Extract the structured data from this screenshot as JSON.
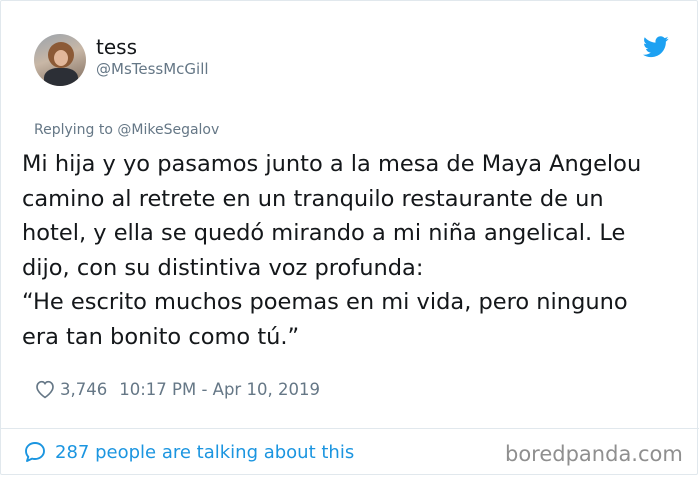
{
  "author": {
    "name": "tess",
    "handle": "@MsTessMcGill"
  },
  "icons": {
    "avatar": "avatar-photo",
    "platform": "twitter-bird-icon",
    "like": "heart-outline-icon",
    "conversation": "speech-bubble-icon"
  },
  "colors": {
    "accent": "#1b95e0",
    "secondary_text": "#657786",
    "primary_text": "#14171a",
    "border": "#e1e8ed",
    "watermark": "#8f8f8f"
  },
  "reply": {
    "text": "Replying to @MikeSegalov"
  },
  "tweet": {
    "lines": [
      "Mi hija y yo pasamos junto a la mesa de Maya Angelou",
      "camino al retrete en un tranquilo restaurante de un",
      "hotel, y ella se quedó mirando a mi niña angelical. Le",
      "dijo, con su distintiva voz profunda:",
      "“He escrito muchos poemas en mi vida, pero ninguno",
      "era tan bonito como tú.”"
    ]
  },
  "meta": {
    "likes": "3,746",
    "timestamp": "10:17 PM - Apr 10, 2019"
  },
  "footer": {
    "talking": "287 people are talking about this",
    "watermark": "boredpanda.com"
  }
}
